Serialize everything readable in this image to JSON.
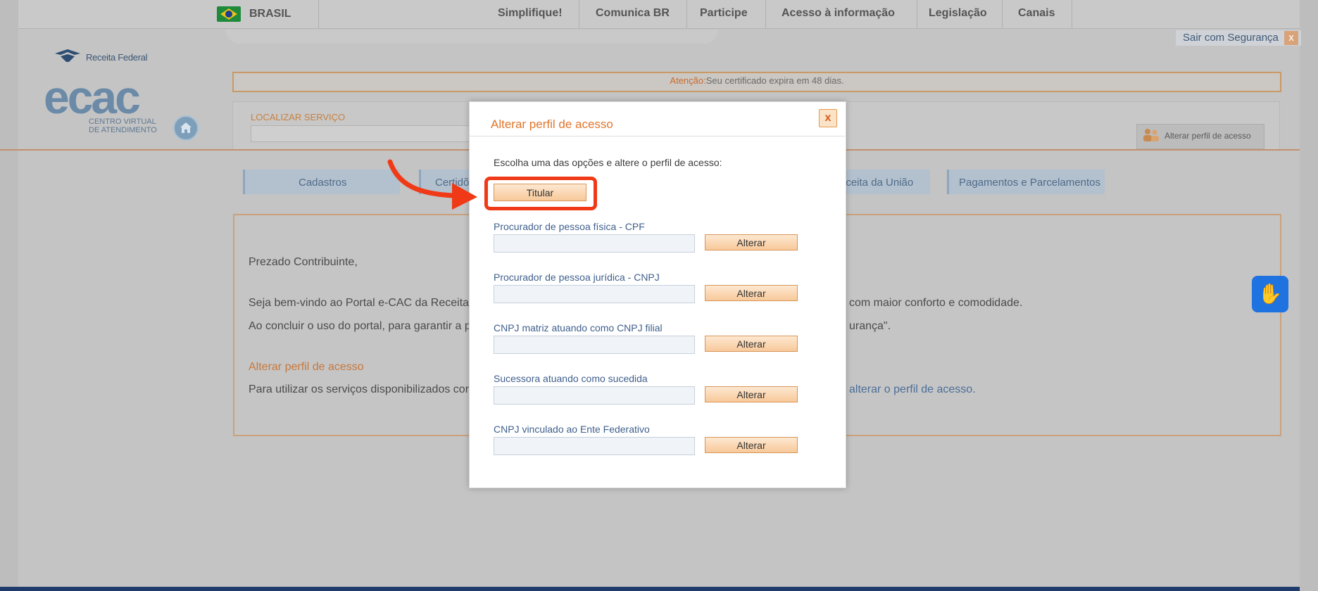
{
  "gov_bar": {
    "country": "BRASIL",
    "nav": [
      "Simplifique!",
      "Comunica BR",
      "Participe",
      "Acesso à informação",
      "Legislação",
      "Canais"
    ]
  },
  "header": {
    "org_name": "Receita Federal",
    "logo_text": "ecac",
    "subtitle_line1": "CENTRO VIRTUAL",
    "subtitle_line2": "DE ATENDIMENTO",
    "logout_label": "Sair com Segurança",
    "logout_close": "x"
  },
  "alert": {
    "label": "Atenção:",
    "message": "Seu certificado expira em 48 dias."
  },
  "search": {
    "label": "LOCALIZAR SERVIÇO",
    "change_profile_button": "Alterar perfil de acesso"
  },
  "tabs": [
    "Cadastros",
    "Certidõ",
    "eceita da União",
    "Pagamentos e Parcelamentos"
  ],
  "content": {
    "greeting": "Prezado Contribuinte,",
    "line1_left": "Seja bem-vindo ao Portal e-CAC da Receita",
    "line1_right": "com maior conforto e comodidade.",
    "line2_left": "Ao concluir o uso do portal, para garantir a p",
    "line2_right": "urança\".",
    "section_title": "Alterar perfil de acesso",
    "line3_left": "Para utilizar os serviços disponibilizados cor",
    "line3_link": "alterar o perfil de acesso."
  },
  "modal": {
    "title": "Alterar perfil de acesso",
    "close": "x",
    "intro": "Escolha uma das opções e altere o perfil de acesso:",
    "titular_button": "Titular",
    "options": [
      {
        "label": "Procurador de pessoa física - CPF",
        "input_value": "",
        "button": "Alterar"
      },
      {
        "label": "Procurador de pessoa jurídica - CNPJ",
        "input_value": "",
        "button": "Alterar"
      },
      {
        "label": "CNPJ matriz atuando como CNPJ filial",
        "input_value": "",
        "button": "Alterar"
      },
      {
        "label": "Sucessora atuando como sucedida",
        "input_value": "",
        "button": "Alterar"
      },
      {
        "label": "CNPJ vinculado ao Ente Federativo",
        "input_value": "",
        "button": "Alterar"
      }
    ]
  },
  "colors": {
    "accent_orange": "#e0762c",
    "highlight_red": "#f03a17",
    "link_blue": "#3f5f8d"
  },
  "icons": {
    "flag": "brazil-flag-icon",
    "home": "home-icon",
    "close": "close-icon",
    "accessibility": "sign-language-icon",
    "annotation": "curved-arrow-icon"
  }
}
